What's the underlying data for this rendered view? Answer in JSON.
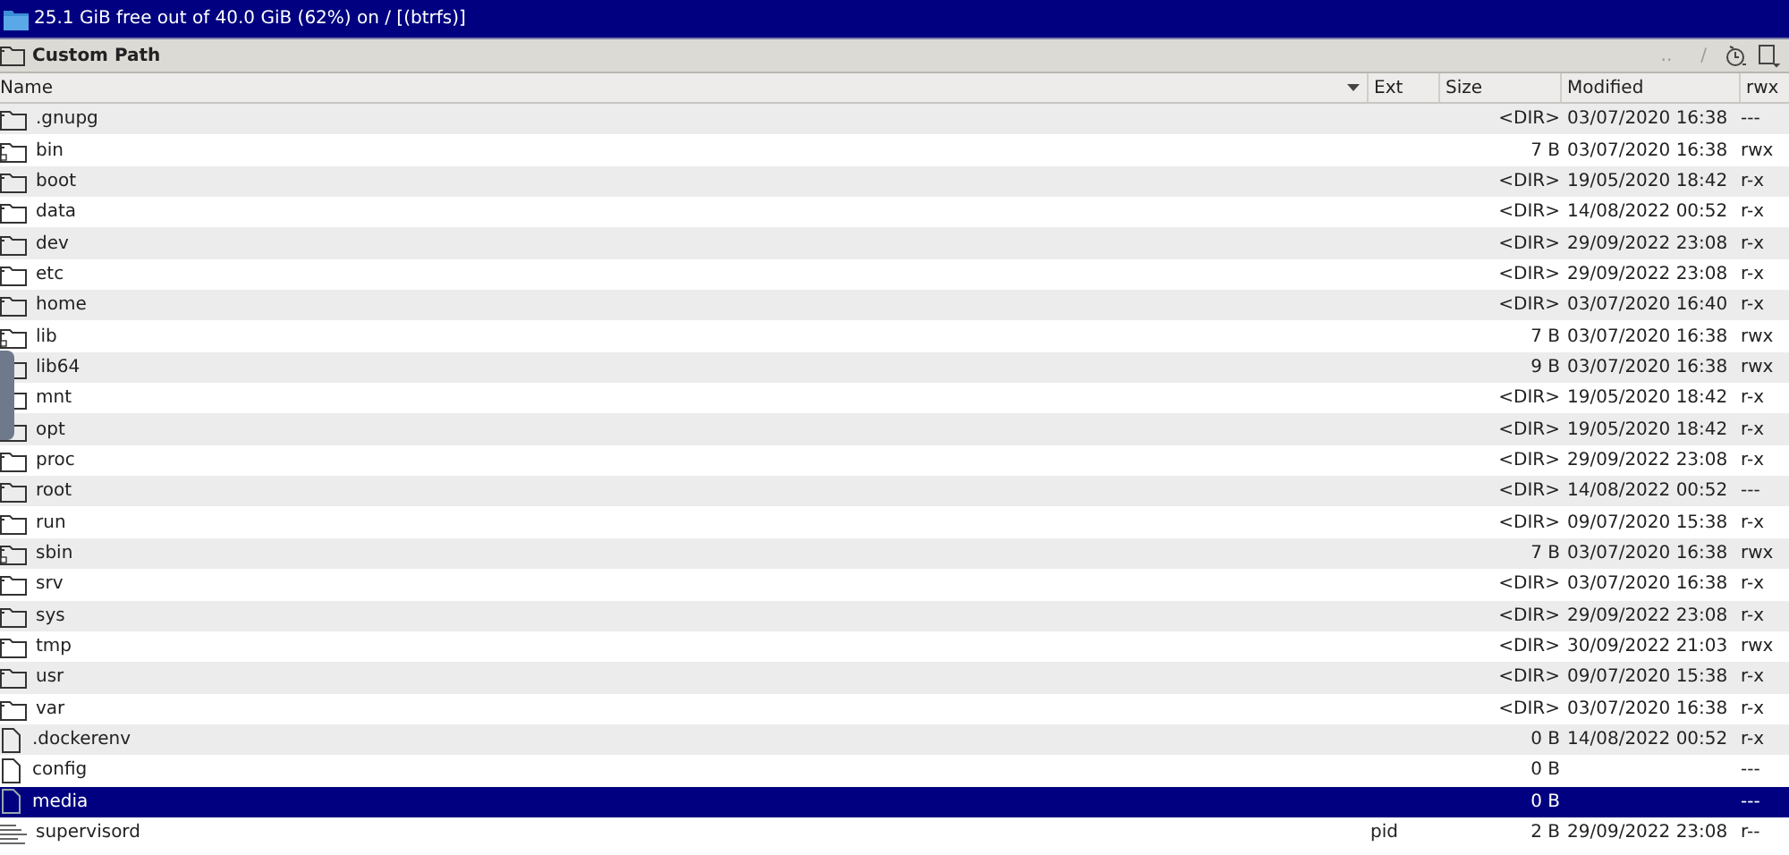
{
  "disk_bar": {
    "text": "25.1 GiB free out of 40.0 GiB (62%) on / [(btrfs)]"
  },
  "panel": {
    "title": "Custom Path",
    "nav": [
      "..",
      "/"
    ]
  },
  "table": {
    "columns": [
      "Name",
      "Ext",
      "Size",
      "Modified",
      "rwx"
    ],
    "rows": [
      {
        "kind": "folder",
        "name": ".gnupg",
        "ext": "",
        "size": "<DIR>",
        "modified": "03/07/2020 16:38",
        "rwx": "---",
        "selected": false
      },
      {
        "kind": "folder-link",
        "name": "bin",
        "ext": "",
        "size": "7 B",
        "modified": "03/07/2020 16:38",
        "rwx": "rwx",
        "selected": false
      },
      {
        "kind": "folder",
        "name": "boot",
        "ext": "",
        "size": "<DIR>",
        "modified": "19/05/2020 18:42",
        "rwx": "r-x",
        "selected": false
      },
      {
        "kind": "folder",
        "name": "data",
        "ext": "",
        "size": "<DIR>",
        "modified": "14/08/2022 00:52",
        "rwx": "r-x",
        "selected": false
      },
      {
        "kind": "folder",
        "name": "dev",
        "ext": "",
        "size": "<DIR>",
        "modified": "29/09/2022 23:08",
        "rwx": "r-x",
        "selected": false
      },
      {
        "kind": "folder",
        "name": "etc",
        "ext": "",
        "size": "<DIR>",
        "modified": "29/09/2022 23:08",
        "rwx": "r-x",
        "selected": false
      },
      {
        "kind": "folder",
        "name": "home",
        "ext": "",
        "size": "<DIR>",
        "modified": "03/07/2020 16:40",
        "rwx": "r-x",
        "selected": false
      },
      {
        "kind": "folder-link",
        "name": "lib",
        "ext": "",
        "size": "7 B",
        "modified": "03/07/2020 16:38",
        "rwx": "rwx",
        "selected": false
      },
      {
        "kind": "folder-link",
        "name": "lib64",
        "ext": "",
        "size": "9 B",
        "modified": "03/07/2020 16:38",
        "rwx": "rwx",
        "selected": false
      },
      {
        "kind": "folder",
        "name": "mnt",
        "ext": "",
        "size": "<DIR>",
        "modified": "19/05/2020 18:42",
        "rwx": "r-x",
        "selected": false
      },
      {
        "kind": "folder",
        "name": "opt",
        "ext": "",
        "size": "<DIR>",
        "modified": "19/05/2020 18:42",
        "rwx": "r-x",
        "selected": false
      },
      {
        "kind": "folder",
        "name": "proc",
        "ext": "",
        "size": "<DIR>",
        "modified": "29/09/2022 23:08",
        "rwx": "r-x",
        "selected": false
      },
      {
        "kind": "folder",
        "name": "root",
        "ext": "",
        "size": "<DIR>",
        "modified": "14/08/2022 00:52",
        "rwx": "---",
        "selected": false
      },
      {
        "kind": "folder",
        "name": "run",
        "ext": "",
        "size": "<DIR>",
        "modified": "09/07/2020 15:38",
        "rwx": "r-x",
        "selected": false
      },
      {
        "kind": "folder-link",
        "name": "sbin",
        "ext": "",
        "size": "7 B",
        "modified": "03/07/2020 16:38",
        "rwx": "rwx",
        "selected": false
      },
      {
        "kind": "folder",
        "name": "srv",
        "ext": "",
        "size": "<DIR>",
        "modified": "03/07/2020 16:38",
        "rwx": "r-x",
        "selected": false
      },
      {
        "kind": "folder",
        "name": "sys",
        "ext": "",
        "size": "<DIR>",
        "modified": "29/09/2022 23:08",
        "rwx": "r-x",
        "selected": false
      },
      {
        "kind": "folder",
        "name": "tmp",
        "ext": "",
        "size": "<DIR>",
        "modified": "30/09/2022 21:03",
        "rwx": "rwx",
        "selected": false
      },
      {
        "kind": "folder",
        "name": "usr",
        "ext": "",
        "size": "<DIR>",
        "modified": "09/07/2020 15:38",
        "rwx": "r-x",
        "selected": false
      },
      {
        "kind": "folder",
        "name": "var",
        "ext": "",
        "size": "<DIR>",
        "modified": "03/07/2020 16:38",
        "rwx": "r-x",
        "selected": false
      },
      {
        "kind": "file",
        "name": ".dockerenv",
        "ext": "",
        "size": "0 B",
        "modified": "14/08/2022 00:52",
        "rwx": "r-x",
        "selected": false
      },
      {
        "kind": "file",
        "name": "config",
        "ext": "",
        "size": "0 B",
        "modified": "",
        "rwx": "---",
        "selected": false
      },
      {
        "kind": "file",
        "name": "media",
        "ext": "",
        "size": "0 B",
        "modified": "",
        "rwx": "---",
        "selected": true
      },
      {
        "kind": "text-file",
        "name": "supervisord",
        "ext": "pid",
        "size": "2 B",
        "modified": "29/09/2022 23:08",
        "rwx": "r--",
        "selected": false
      }
    ]
  }
}
